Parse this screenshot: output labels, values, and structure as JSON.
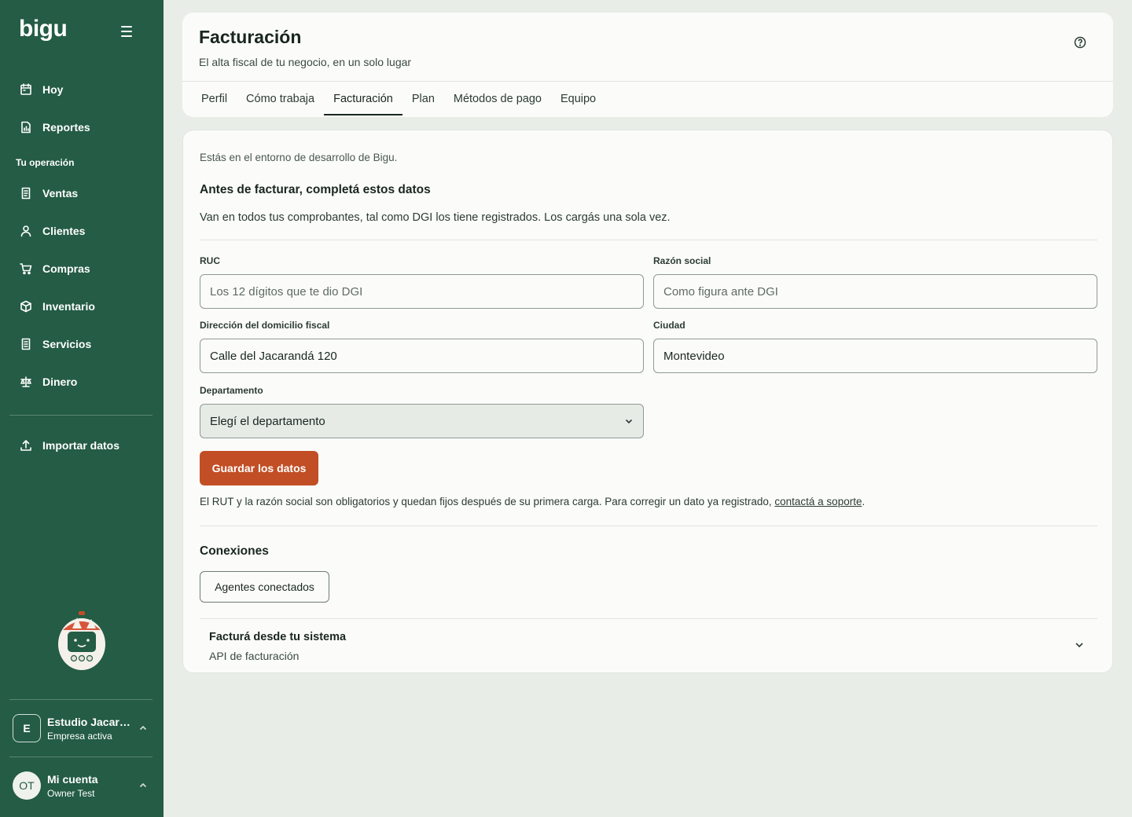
{
  "brand": {
    "logo_text": "bigu",
    "sidebar_bg": "#245c45",
    "accent": "#c24e25"
  },
  "sidebar": {
    "primary_items": [
      {
        "label": "Hoy",
        "icon": "calendar-icon"
      },
      {
        "label": "Reportes",
        "icon": "report-icon"
      }
    ],
    "section_label": "Tu operación",
    "operation_items": [
      {
        "label": "Ventas",
        "icon": "receipt-icon"
      },
      {
        "label": "Clientes",
        "icon": "user-icon"
      },
      {
        "label": "Compras",
        "icon": "cart-icon"
      },
      {
        "label": "Inventario",
        "icon": "box-icon"
      },
      {
        "label": "Servicios",
        "icon": "document-icon"
      },
      {
        "label": "Dinero",
        "icon": "scale-icon"
      }
    ],
    "import_item": {
      "label": "Importar datos",
      "icon": "upload-icon"
    },
    "company": {
      "initial": "E",
      "name": "Estudio Jacarandá",
      "status": "Empresa activa"
    },
    "account": {
      "initials": "OT",
      "title": "Mi cuenta",
      "user": "Owner Test"
    }
  },
  "header": {
    "title": "Facturación",
    "subtitle": "El alta fiscal de tu negocio, en un solo lugar",
    "tabs": [
      {
        "label": "Perfil",
        "active": false
      },
      {
        "label": "Cómo trabaja",
        "active": false
      },
      {
        "label": "Facturación",
        "active": true
      },
      {
        "label": "Plan",
        "active": false
      },
      {
        "label": "Métodos de pago",
        "active": false
      },
      {
        "label": "Equipo",
        "active": false
      }
    ]
  },
  "billing": {
    "env_note": "Estás en el entorno de desarrollo de Bigu.",
    "title": "Antes de facturar, completá estos datos",
    "description": "Van en todos tus comprobantes, tal como DGI los tiene registrados. Los cargás una sola vez.",
    "fields": {
      "ruc": {
        "label": "RUC",
        "value": "",
        "placeholder": "Los 12 dígitos que te dio DGI"
      },
      "razon_social": {
        "label": "Razón social",
        "value": "",
        "placeholder": "Como figura ante DGI"
      },
      "direccion": {
        "label": "Dirección del domicilio fiscal",
        "value": "Calle del Jacarandá 120",
        "placeholder": ""
      },
      "ciudad": {
        "label": "Ciudad",
        "value": "Montevideo",
        "placeholder": ""
      },
      "departamento": {
        "label": "Departamento",
        "selected": "Elegí el departamento"
      }
    },
    "save_label": "Guardar los datos",
    "legal_text": "El RUT y la razón social son obligatorios y quedan fijos después de su primera carga. Para corregir un dato ya registrado, ",
    "legal_link": "contactá a soporte",
    "legal_end": "."
  },
  "connections": {
    "title": "Conexiones",
    "agents_button": "Agentes conectados",
    "api_accordion": {
      "title": "Facturá desde tu sistema",
      "subtitle": "API de facturación"
    }
  }
}
